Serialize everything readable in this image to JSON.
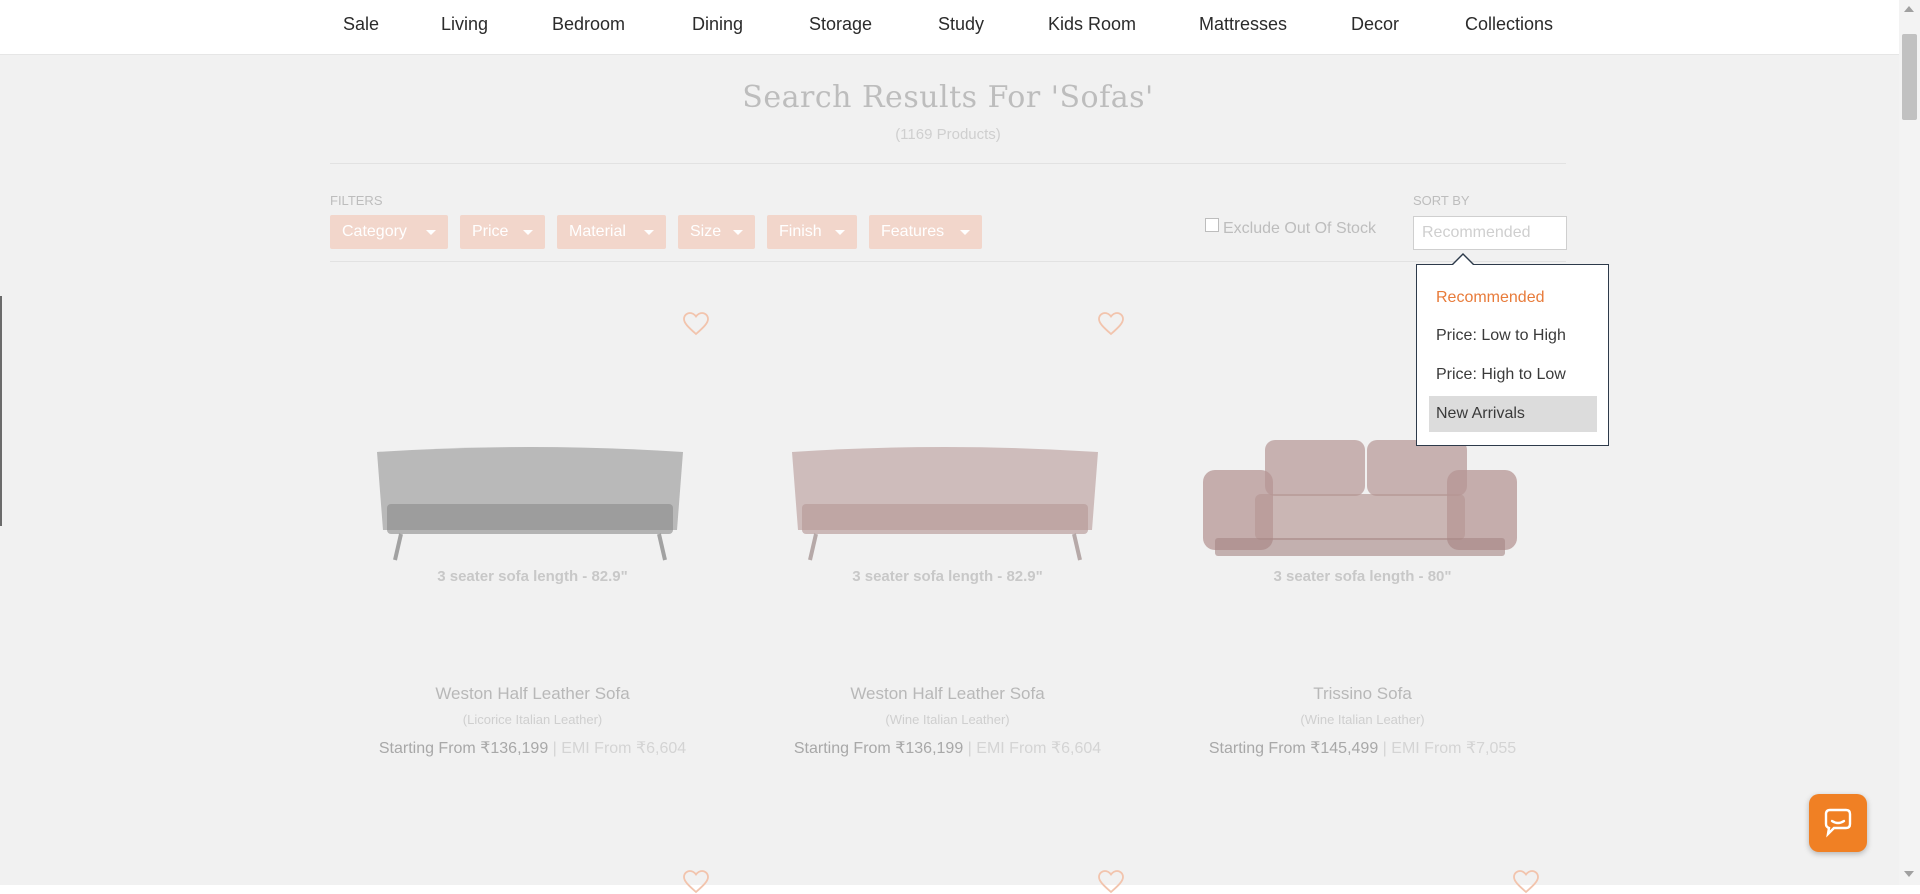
{
  "nav": {
    "items": [
      "Sale",
      "Living",
      "Bedroom",
      "Dining",
      "Storage",
      "Study",
      "Kids Room",
      "Mattresses",
      "Decor",
      "Collections"
    ]
  },
  "search": {
    "title": "Search Results For 'Sofas'",
    "count": "(1169 Products)"
  },
  "filters": {
    "label": "FILTERS",
    "buttons": [
      "Category",
      "Price",
      "Material",
      "Size",
      "Finish",
      "Features"
    ],
    "exclude_label": "Exclude Out Of Stock"
  },
  "sort": {
    "label": "SORT BY",
    "selected": "Recommended",
    "options": [
      "Recommended",
      "Price: Low to High",
      "Price: High to Low",
      "New Arrivals"
    ],
    "active_option": "Recommended",
    "hovered_option": "New Arrivals"
  },
  "products": [
    {
      "caption": "3 seater sofa length - 82.9\"",
      "name": "Weston Half Leather Sofa",
      "variant": "(Licorice Italian Leather)",
      "starting": "Starting From ₹136,199",
      "emi": "| EMI From ₹6,604",
      "color": "#8a8a8a"
    },
    {
      "caption": "3 seater sofa length - 82.9\"",
      "name": "Weston Half Leather Sofa",
      "variant": "(Wine Italian Leather)",
      "starting": "Starting From ₹136,199",
      "emi": "| EMI From ₹6,604",
      "color": "#b79a98"
    },
    {
      "caption": "3 seater sofa length - 80\"",
      "name": "Trissino Sofa",
      "variant": "(Wine Italian Leather)",
      "starting": "Starting From ₹145,499",
      "emi": "| EMI From ₹7,055",
      "color": "#b59694"
    }
  ],
  "colors": {
    "accent": "#f08024",
    "filter_button": "#f2d6cb",
    "active_option": "#e87b3a",
    "heart": "#f2c4ad"
  }
}
